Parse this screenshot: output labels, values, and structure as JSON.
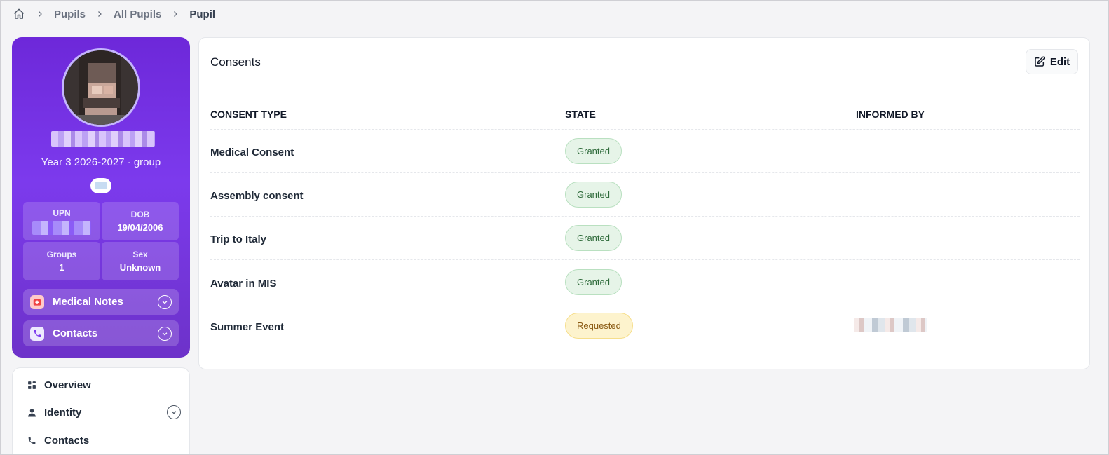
{
  "breadcrumb": {
    "home_icon": "home-icon",
    "items": [
      "Pupils",
      "All Pupils",
      "Pupil"
    ]
  },
  "profile": {
    "group_line": "Year 3 2026-2027 · group",
    "stats": [
      {
        "label": "UPN",
        "value": ""
      },
      {
        "label": "DOB",
        "value": "19/04/2006"
      },
      {
        "label": "Groups",
        "value": "1"
      },
      {
        "label": "Sex",
        "value": "Unknown"
      }
    ],
    "accordions": [
      {
        "label": "Medical Notes",
        "icon": "medical-icon",
        "color": "#ef4444"
      },
      {
        "label": "Contacts",
        "icon": "phone-icon",
        "color": "#7c3aed"
      }
    ],
    "gradient": [
      "#6d28d9",
      "#7c3aed"
    ]
  },
  "nav": {
    "items": [
      {
        "label": "Overview",
        "icon": "grid-icon"
      },
      {
        "label": "Identity",
        "icon": "person-icon"
      },
      {
        "label": "Contacts",
        "icon": "phone-icon"
      }
    ]
  },
  "consents": {
    "title": "Consents",
    "edit_label": "Edit",
    "columns": [
      "CONSENT TYPE",
      "STATE",
      "INFORMED BY"
    ],
    "rows": [
      {
        "type": "Medical Consent",
        "state": "Granted",
        "informed_by": ""
      },
      {
        "type": "Assembly consent",
        "state": "Granted",
        "informed_by": ""
      },
      {
        "type": "Trip to Italy",
        "state": "Granted",
        "informed_by": ""
      },
      {
        "type": "Avatar in MIS",
        "state": "Granted",
        "informed_by": ""
      },
      {
        "type": "Summer Event",
        "state": "Requested",
        "informed_by": ""
      }
    ],
    "colors": {
      "granted": "#2f6b3b",
      "requested": "#8a5a12"
    }
  }
}
